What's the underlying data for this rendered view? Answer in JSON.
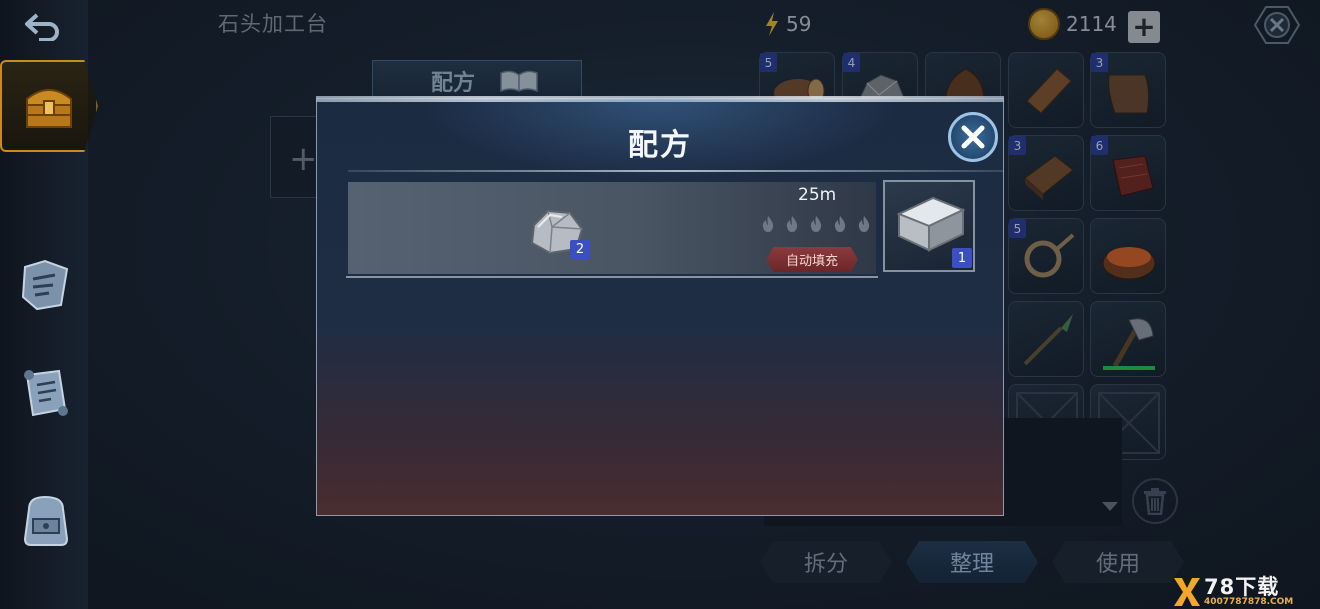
{
  "screen": {
    "station_title": "石头加工台",
    "background_tab_label": "配方"
  },
  "top_bar": {
    "energy_value": "59",
    "gold_value": "2114",
    "add_gold_label": "+"
  },
  "sidebar": {
    "items": [
      {
        "icon": "back-arrow-icon"
      },
      {
        "icon": "treasure-chest-icon",
        "active": true
      },
      {
        "icon": "blueprint-map-icon"
      },
      {
        "icon": "scroll-icon"
      },
      {
        "icon": "backpack-icon"
      }
    ]
  },
  "inventory": {
    "slots": [
      {
        "badge": "5",
        "icon": "log-icon"
      },
      {
        "badge": "4",
        "icon": "stone-pile-icon"
      },
      {
        "badge": "",
        "icon": "hide-icon"
      },
      {
        "badge": "",
        "icon": "wood-plank-icon"
      },
      {
        "badge": "3",
        "icon": "leather-icon"
      },
      {
        "badge": "3",
        "icon": "wooden-board-icon"
      },
      {
        "badge": "6",
        "icon": "meat-icon"
      },
      {
        "badge": "5",
        "icon": "rope-icon"
      },
      {
        "badge": "",
        "icon": "fire-bowl-icon"
      },
      {
        "badge": "",
        "icon": "spear-icon"
      },
      {
        "badge": "",
        "icon": "axe-icon",
        "durability": 1.0
      },
      {
        "badge": "",
        "icon": "empty-slot-icon"
      },
      {
        "badge": "",
        "icon": "empty-slot-icon"
      }
    ],
    "buttons": {
      "split": "拆分",
      "organize": "整理",
      "use": "使用"
    }
  },
  "dialog": {
    "title": "配方",
    "recipe": {
      "ingredient_icon": "stone-icon",
      "ingredient_count": "2",
      "craft_time": "25m",
      "flame_count": 5,
      "autofill_label": "自动填充",
      "output_icon": "stone-block-icon",
      "output_count": "1"
    }
  },
  "watermark": {
    "brand": "78下载",
    "site": "4007787878.COM"
  },
  "colors": {
    "accent_gold": "#c98a22",
    "badge_blue": "#3b4fc2",
    "autofill_red": "#8c3a3d"
  }
}
